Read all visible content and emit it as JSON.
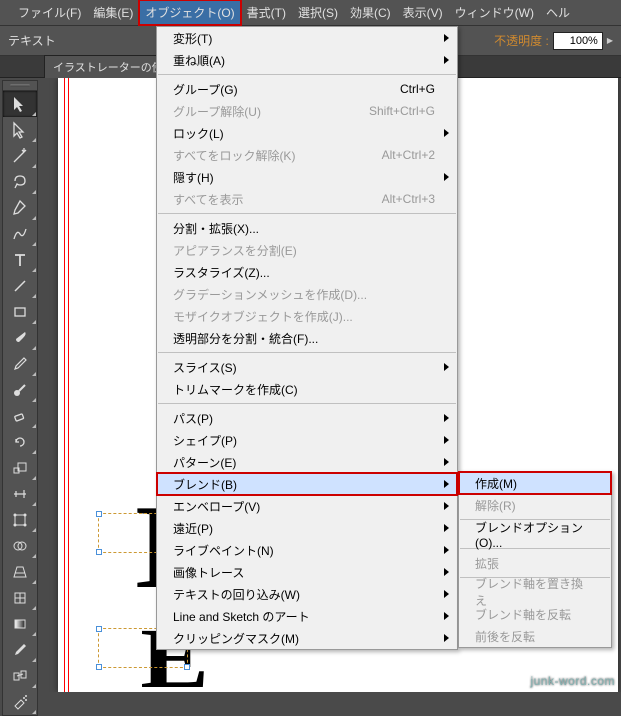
{
  "menubar": {
    "items": [
      {
        "label": "ファイル(F)"
      },
      {
        "label": "編集(E)"
      },
      {
        "label": "オブジェクト(O)",
        "open": true
      },
      {
        "label": "書式(T)"
      },
      {
        "label": "選択(S)"
      },
      {
        "label": "効果(C)"
      },
      {
        "label": "表示(V)"
      },
      {
        "label": "ウィンドウ(W)"
      },
      {
        "label": "ヘル"
      }
    ]
  },
  "options_bar": {
    "left_label": "テキスト",
    "opacity_label": "不透明度 :",
    "opacity_value": "100%"
  },
  "tab": {
    "title": "イラストレーターの使"
  },
  "tools": [
    "selection",
    "direct-selection",
    "magic-wand",
    "lasso",
    "pen",
    "curvature",
    "type",
    "line",
    "rectangle",
    "paintbrush",
    "pencil",
    "blob-brush",
    "eraser",
    "rotate",
    "scale",
    "width",
    "free-transform",
    "shape-builder",
    "perspective",
    "mesh",
    "gradient",
    "eyedropper",
    "blend",
    "symbol-sprayer"
  ],
  "object_menu": {
    "groups": [
      [
        {
          "label": "変形(T)",
          "submenu": true
        },
        {
          "label": "重ね順(A)",
          "submenu": true
        }
      ],
      [
        {
          "label": "グループ(G)",
          "shortcut": "Ctrl+G"
        },
        {
          "label": "グループ解除(U)",
          "shortcut": "Shift+Ctrl+G",
          "disabled": true
        },
        {
          "label": "ロック(L)",
          "submenu": true
        },
        {
          "label": "すべてをロック解除(K)",
          "shortcut": "Alt+Ctrl+2",
          "disabled": true
        },
        {
          "label": "隠す(H)",
          "submenu": true
        },
        {
          "label": "すべてを表示",
          "shortcut": "Alt+Ctrl+3",
          "disabled": true
        }
      ],
      [
        {
          "label": "分割・拡張(X)..."
        },
        {
          "label": "アピアランスを分割(E)",
          "disabled": true
        },
        {
          "label": "ラスタライズ(Z)..."
        },
        {
          "label": "グラデーションメッシュを作成(D)...",
          "disabled": true
        },
        {
          "label": "モザイクオブジェクトを作成(J)...",
          "disabled": true
        },
        {
          "label": "透明部分を分割・統合(F)..."
        }
      ],
      [
        {
          "label": "スライス(S)",
          "submenu": true
        },
        {
          "label": "トリムマークを作成(C)"
        }
      ],
      [
        {
          "label": "パス(P)",
          "submenu": true
        },
        {
          "label": "シェイプ(P)",
          "submenu": true
        },
        {
          "label": "パターン(E)",
          "submenu": true
        },
        {
          "label": "ブレンド(B)",
          "submenu": true,
          "highlight": true
        },
        {
          "label": "エンベロープ(V)",
          "submenu": true
        },
        {
          "label": "遠近(P)",
          "submenu": true
        },
        {
          "label": "ライブペイント(N)",
          "submenu": true
        },
        {
          "label": "画像トレース",
          "submenu": true
        },
        {
          "label": "テキストの回り込み(W)",
          "submenu": true
        },
        {
          "label": "Line and Sketch のアート",
          "submenu": true
        },
        {
          "label": "クリッピングマスク(M)",
          "submenu": true
        }
      ]
    ]
  },
  "blend_submenu": {
    "groups": [
      [
        {
          "label": "作成(M)",
          "highlight": true
        },
        {
          "label": "解除(R)",
          "disabled": true
        }
      ],
      [
        {
          "label": "ブレンドオプション(O)..."
        }
      ],
      [
        {
          "label": "拡張",
          "disabled": true
        }
      ],
      [
        {
          "label": "ブレンド軸を置き換え",
          "disabled": true
        },
        {
          "label": "ブレンド軸を反転",
          "disabled": true
        },
        {
          "label": "前後を反転",
          "disabled": true
        }
      ]
    ]
  },
  "watermark": "junk-word.com"
}
